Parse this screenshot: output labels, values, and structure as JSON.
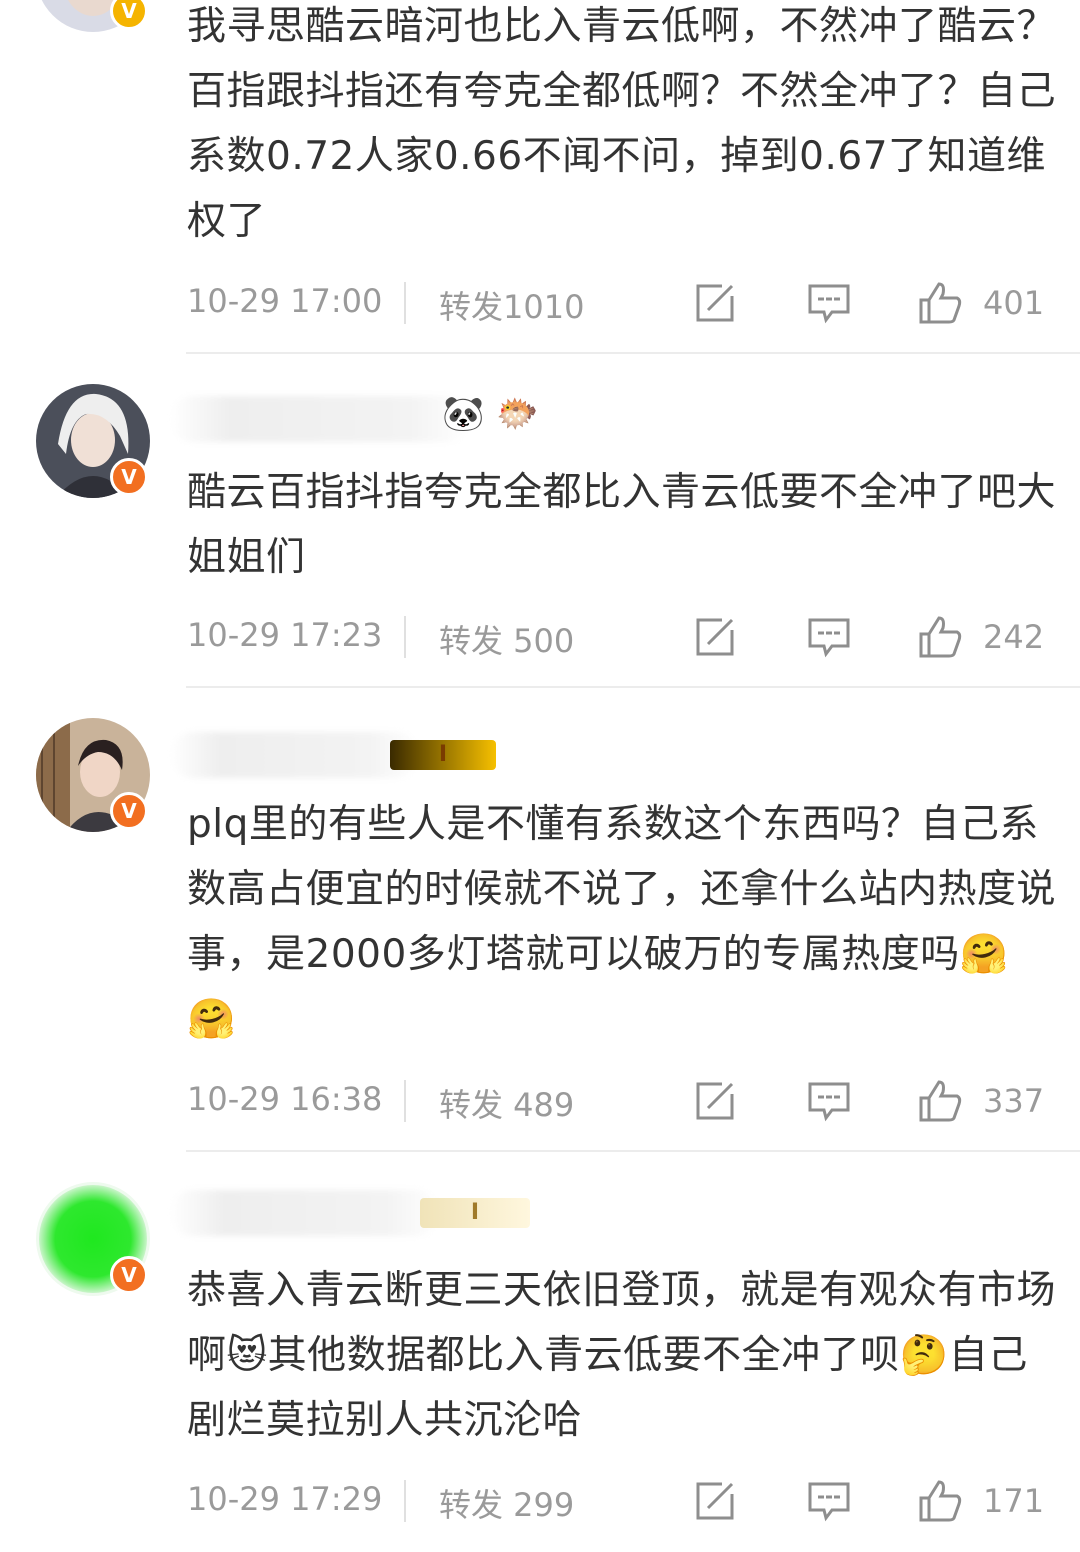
{
  "posts": [
    {
      "body": "我寻思酷云暗河也比入青云低啊，不然冲了酷云？百指跟抖指还有夸克全都低啊？不然全冲了？自己系数0.72人家0.66不闻不问，掉到0.67了知道维权了",
      "time": "10-29 17:00",
      "repost": "转发1010",
      "likes": "401"
    },
    {
      "body": "酷云百指抖指夸克全都比入青云低要不全冲了吧大姐姐们",
      "time": "10-29 17:23",
      "repost": "转发 500",
      "likes": "242"
    },
    {
      "body": "plq里的有些人是不懂有系数这个东西吗？自己系数高占便宜的时候就不说了，还拿什么站内热度说事，是2000多灯塔就可以破万的专属热度吗🤗🤗",
      "time": "10-29 16:38",
      "repost": "转发 489",
      "likes": "337"
    },
    {
      "body": "恭喜入青云断更三天依旧登顶，就是有观众有市场啊😻其他数据都比入青云低要不全冲了呗🤔自己剧烂莫拉别人共沉沦哈",
      "time": "10-29 17:29",
      "repost": "转发 299",
      "likes": "171"
    }
  ],
  "badges": {
    "post2": [
      "🐼",
      "🐡"
    ],
    "post3": "I",
    "post4": "I"
  },
  "icons": {
    "verified": "V",
    "share": "share-icon",
    "comment": "comment-icon",
    "like": "like-icon"
  },
  "colors": {
    "text": "#333333",
    "meta": "#9a9a9a",
    "verified_gold": "#f5b400",
    "verified_orange": "#f26f21",
    "divider": "#ececec"
  }
}
